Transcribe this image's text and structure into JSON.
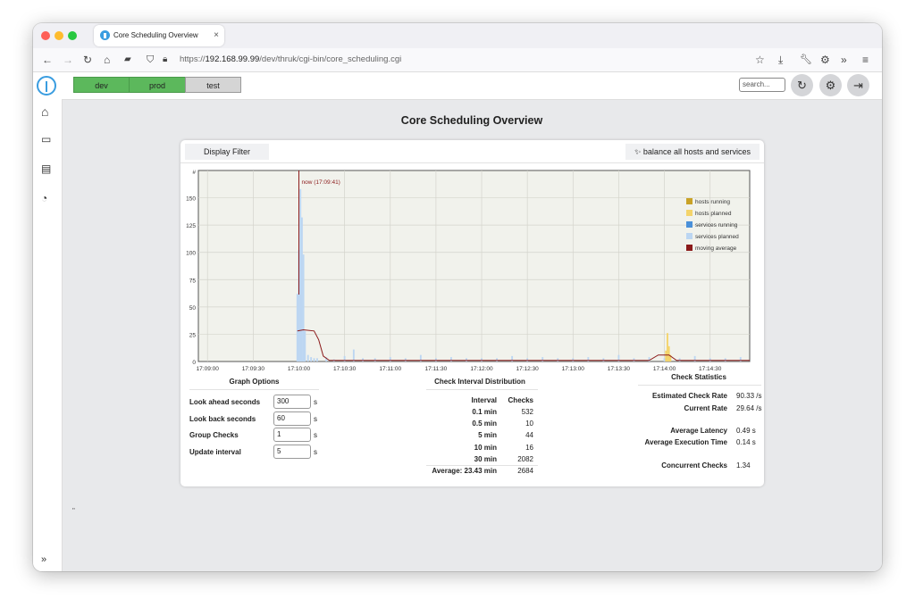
{
  "browser": {
    "tab_title": "Core Scheduling Overview",
    "tab_close": "×",
    "url_prefix": "https://",
    "url_host": "192.168.99.99",
    "url_path": "/dev/thruk/cgi-bin/core_scheduling.cgi"
  },
  "topbar": {
    "envs": [
      "dev",
      "prod",
      "test"
    ],
    "search_placeholder": "search...",
    "colors": {
      "active": "#5cb85c",
      "inactive": "#d5d5d5"
    }
  },
  "page": {
    "title": "Core Scheduling Overview",
    "footnote": "\""
  },
  "panel": {
    "display_filter": "Display Filter",
    "balance": "balance all hosts and services"
  },
  "chart_data": {
    "type": "bar",
    "ylabel": "#",
    "ylim": [
      0,
      175
    ],
    "yticks": [
      0,
      25,
      50,
      75,
      100,
      125,
      150
    ],
    "xticks": [
      "17:09:00",
      "17:09:30",
      "17:10:00",
      "17:10:30",
      "17:11:00",
      "17:11:30",
      "17:12:00",
      "17:12:30",
      "17:13:00",
      "17:13:30",
      "17:14:00",
      "17:14:30"
    ],
    "x_range_seconds": [
      -66,
      296
    ],
    "now_label": "now (17:09:41)",
    "legend": [
      {
        "name": "hosts running",
        "color": "#c9a227"
      },
      {
        "name": "hosts planned",
        "color": "#f4d46b"
      },
      {
        "name": "services running",
        "color": "#4a90d9"
      },
      {
        "name": "services planned",
        "color": "#bcd6f2"
      },
      {
        "name": "moving average",
        "color": "#8b1a1a"
      }
    ],
    "series": [
      {
        "name": "services planned",
        "points": [
          [
            -1,
            62
          ],
          [
            0,
            102
          ],
          [
            1,
            158
          ],
          [
            2,
            132
          ],
          [
            3,
            98
          ],
          [
            4,
            28
          ],
          [
            6,
            6
          ],
          [
            8,
            4
          ],
          [
            10,
            3
          ],
          [
            12,
            3
          ],
          [
            18,
            4
          ],
          [
            23,
            2
          ],
          [
            30,
            5
          ],
          [
            36,
            11
          ],
          [
            42,
            3
          ],
          [
            50,
            3
          ],
          [
            60,
            4
          ],
          [
            70,
            3
          ],
          [
            80,
            6
          ],
          [
            90,
            3
          ],
          [
            100,
            4
          ],
          [
            110,
            3
          ],
          [
            120,
            3
          ],
          [
            130,
            3
          ],
          [
            140,
            5
          ],
          [
            150,
            3
          ],
          [
            160,
            4
          ],
          [
            170,
            3
          ],
          [
            180,
            3
          ],
          [
            190,
            4
          ],
          [
            200,
            3
          ],
          [
            210,
            6
          ],
          [
            220,
            3
          ],
          [
            230,
            4
          ],
          [
            240,
            3
          ],
          [
            250,
            3
          ],
          [
            260,
            5
          ],
          [
            270,
            3
          ],
          [
            280,
            3
          ],
          [
            290,
            4
          ]
        ]
      },
      {
        "name": "hosts planned",
        "points": [
          [
            241,
            10
          ],
          [
            242,
            26
          ],
          [
            243,
            14
          ],
          [
            244,
            6
          ]
        ]
      },
      {
        "name": "moving average",
        "points": [
          [
            -1,
            28
          ],
          [
            3,
            29
          ],
          [
            10,
            28
          ],
          [
            13,
            20
          ],
          [
            16,
            5
          ],
          [
            20,
            1
          ],
          [
            60,
            1
          ],
          [
            200,
            1
          ],
          [
            230,
            1
          ],
          [
            236,
            6
          ],
          [
            243,
            6
          ],
          [
            248,
            1
          ],
          [
            296,
            1
          ]
        ]
      }
    ]
  },
  "graph_options": {
    "title": "Graph Options",
    "rows": [
      {
        "label": "Look ahead seconds",
        "value": "300",
        "unit": "s"
      },
      {
        "label": "Look back seconds",
        "value": "60",
        "unit": "s"
      },
      {
        "label": "Group Checks",
        "value": "1",
        "unit": "s"
      },
      {
        "label": "Update interval",
        "value": "5",
        "unit": "s"
      }
    ]
  },
  "check_interval": {
    "title": "Check Interval Distribution",
    "header": [
      "Interval",
      "Checks"
    ],
    "rows": [
      [
        "0.1 min",
        "532"
      ],
      [
        "0.5 min",
        "10"
      ],
      [
        "5 min",
        "44"
      ],
      [
        "10 min",
        "16"
      ],
      [
        "30 min",
        "2082"
      ]
    ],
    "footer": [
      "Average: 23.43 min",
      "2684"
    ]
  },
  "check_statistics": {
    "title": "Check Statistics",
    "rows": [
      {
        "label": "Estimated Check Rate",
        "value": "90.33 /s"
      },
      {
        "label": "Current Rate",
        "value": "29.64 /s"
      },
      {
        "label": "Average Latency",
        "value": "0.49 s"
      },
      {
        "label": "Average Execution Time",
        "value": "0.14 s"
      },
      {
        "label": "Concurrent Checks",
        "value": "1.34"
      }
    ]
  }
}
